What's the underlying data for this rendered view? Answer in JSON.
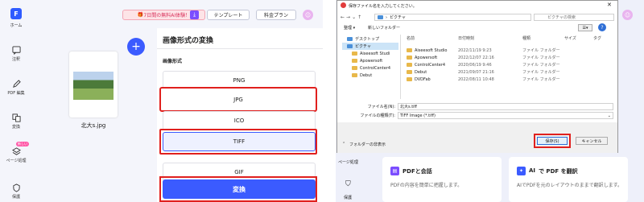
{
  "left": {
    "sidebar": {
      "logo_label": "ホーム",
      "items": [
        {
          "label": "注釈"
        },
        {
          "label": "PDF 編集"
        },
        {
          "label": "変換"
        },
        {
          "label": "ページ処理",
          "badge": "新しい"
        },
        {
          "label": "保護"
        }
      ]
    },
    "topbar": {
      "trial": "7日間の無料AI体験！",
      "template": "テンプレート",
      "pricing": "料金プラン"
    },
    "file": {
      "name": "北大s.jpg"
    },
    "panel": {
      "title": "画像形式の変換",
      "section": "画像形式",
      "formats": [
        "PNG",
        "JPG",
        "ICO",
        "TIFF",
        "GIF"
      ],
      "convert": "変換"
    }
  },
  "right": {
    "dialog": {
      "title": "保存ファイル名を入力してください。",
      "address": "ピクチャ",
      "search_placeholder": "ピクチャの検索",
      "toolbar": {
        "organize": "整理 ▾",
        "new_folder": "新しいフォルダー"
      },
      "tree": [
        "デスクトップ",
        "ピクチャ",
        "Aiseesoft Studi",
        "Apowersoft",
        "ControlCenter4",
        "Debut"
      ],
      "columns": [
        "名前",
        "日付時刻",
        "種類",
        "サイズ",
        "タグ"
      ],
      "rows": [
        {
          "name": "Aiseesoft Studio",
          "date": "2022/11/19 9:23",
          "type": "ファイル フォルダー"
        },
        {
          "name": "Apowersoft",
          "date": "2022/12/07 22:16",
          "type": "ファイル フォルダー"
        },
        {
          "name": "ControlCenter4",
          "date": "2020/06/19 9:46",
          "type": "ファイル フォルダー"
        },
        {
          "name": "Debut",
          "date": "2021/09/07 21:16",
          "type": "ファイル フォルダー"
        },
        {
          "name": "DVDFab",
          "date": "2022/08/11 10:48",
          "type": "ファイル フォルダー"
        }
      ],
      "filename_label": "ファイル名(N):",
      "filename_value": "北大s.tiff",
      "filetype_label": "ファイルの種類(T):",
      "filetype_value": "TIFF Image (*.tiff)",
      "hide_folders": "フォルダーの非表示",
      "save": "保存(S)",
      "cancel": "キャンセル"
    },
    "bg": {
      "sidebar_label": "ページ処理",
      "sidebar_label2": "保護",
      "card1_title": "PDFと会話",
      "card1_text": "PDFの内容を簡単に把握します。",
      "card2_ai": "AI",
      "card2_title": "で PDF を翻訳",
      "card2_text": "AIでPDFを元のレイアウトのままで翻訳します。"
    }
  }
}
